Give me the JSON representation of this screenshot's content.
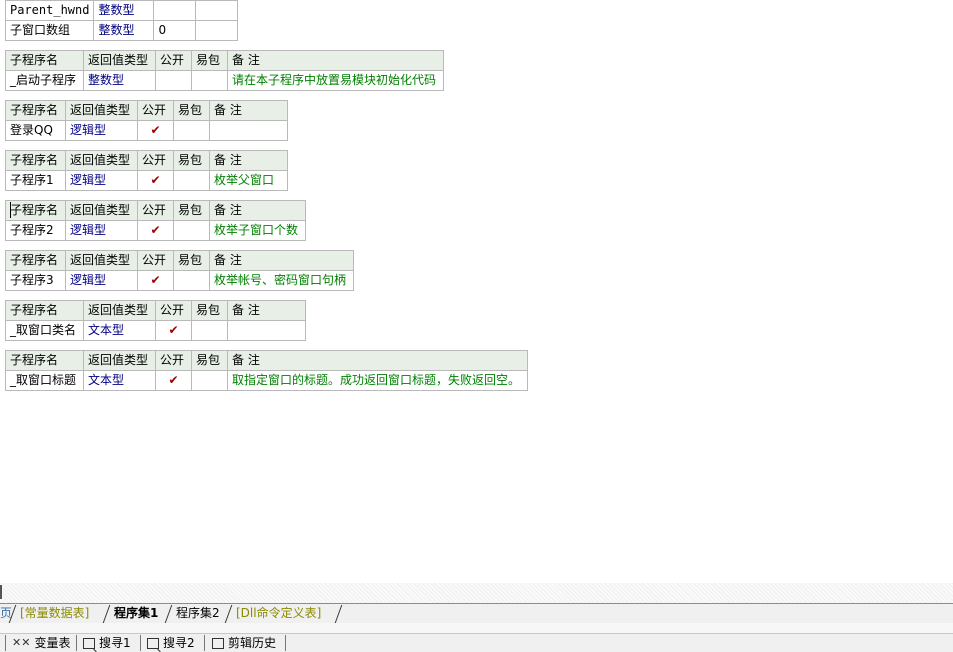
{
  "var_table": {
    "rows": [
      {
        "name": "Parent_hwnd",
        "type": "整数型",
        "value": "",
        "extra": ""
      },
      {
        "name": "子窗口数组",
        "type": "整数型",
        "value": "0",
        "extra": ""
      }
    ]
  },
  "headers": {
    "name": "子程序名",
    "return_type": "返回值类型",
    "public": "公开",
    "easy_pkg": "易包",
    "note": "备 注"
  },
  "subprograms": [
    {
      "name": "_启动子程序",
      "type": "整数型",
      "public": "",
      "easy_pkg": "",
      "note": "请在本子程序中放置易模块初始化代码"
    },
    {
      "name": "登录QQ",
      "type": "逻辑型",
      "public": "✔",
      "easy_pkg": "",
      "note": ""
    },
    {
      "name": "子程序1",
      "type": "逻辑型",
      "public": "✔",
      "easy_pkg": "",
      "note": "枚举父窗口"
    },
    {
      "name": "子程序2",
      "type": "逻辑型",
      "public": "✔",
      "easy_pkg": "",
      "note": "枚举子窗口个数"
    },
    {
      "name": "子程序3",
      "type": "逻辑型",
      "public": "✔",
      "easy_pkg": "",
      "note": "枚举帐号、密码窗口句柄"
    },
    {
      "name": "_取窗口类名",
      "type": "文本型",
      "public": "✔",
      "easy_pkg": "",
      "note": ""
    },
    {
      "name": "_取窗口标题",
      "type": "文本型",
      "public": "✔",
      "easy_pkg": "",
      "note": "取指定窗口的标题。成功返回窗口标题，失败返回空。"
    }
  ],
  "tabs": [
    {
      "label": "页",
      "active": false
    },
    {
      "label": "[常量数据表]",
      "active": false
    },
    {
      "label": "程序集1",
      "active": true
    },
    {
      "label": "程序集2",
      "active": false
    },
    {
      "label": "[Dll命令定义表]",
      "active": false
    }
  ],
  "panels": [
    {
      "label": "变量表",
      "icon": "variables-icon"
    },
    {
      "label": "搜寻1",
      "icon": "search-icon"
    },
    {
      "label": "搜寻2",
      "icon": "search-icon"
    },
    {
      "label": "剪辑历史",
      "icon": "clipboard-icon"
    }
  ],
  "colors": {
    "header_bg": "#e7efe7",
    "type_text": "#000080",
    "note_text": "#008000",
    "check": "#a00000",
    "bracket_tab_text": "#8a8a00"
  }
}
